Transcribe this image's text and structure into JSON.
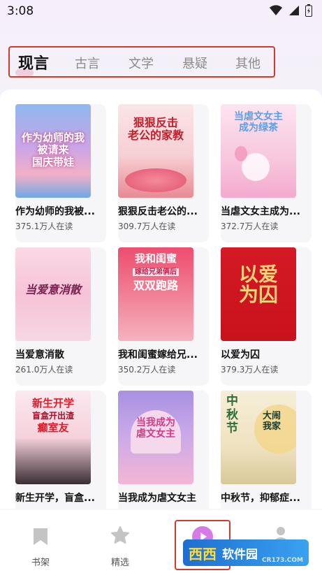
{
  "status": {
    "time": "3:08"
  },
  "tabs": [
    {
      "label": "现言",
      "active": true
    },
    {
      "label": "古言",
      "active": false
    },
    {
      "label": "文学",
      "active": false
    },
    {
      "label": "悬疑",
      "active": false
    },
    {
      "label": "其他",
      "active": false
    }
  ],
  "books": [
    {
      "title": "作为幼师的我被...",
      "readers": "375.1万人在读",
      "cover_text": "作为幼师的我 被请来 国庆带娃"
    },
    {
      "title": "狠狠反击老公的...",
      "readers": "309.7万人在读",
      "cover_text": "狠狠反击 老公的家教"
    },
    {
      "title": "当虐文女主成为...",
      "readers": "372.7万人在读",
      "cover_text": "当虐文女主 成为绿茶"
    },
    {
      "title": "当爱意消散",
      "readers": "261.0万人在读",
      "cover_text": "当爱意消散"
    },
    {
      "title": "我和闺蜜嫁给兄...",
      "readers": "350.2万人在读",
      "cover_text": "我和闺蜜 嫁给兄弟俩后 双双跑路"
    },
    {
      "title": "以爱为囚",
      "readers": "379.3万人在读",
      "cover_text": "以爱为囚"
    },
    {
      "title": "新生开学，盲盒...",
      "readers": "",
      "cover_text": "新生开学 盲盒开出渣 癫室友"
    },
    {
      "title": "当我成为虐文女主",
      "readers": "",
      "cover_text": "当我成为 虐文女主"
    },
    {
      "title": "中秋节，抑郁症...",
      "readers": "",
      "cover_text": "中秋节 大闹我家"
    }
  ],
  "nav": [
    {
      "label": "书架",
      "icon": "bookmark-icon"
    },
    {
      "label": "精选",
      "icon": "star-icon"
    },
    {
      "label": "",
      "icon": "play-icon"
    },
    {
      "label": "",
      "icon": "profile-icon"
    }
  ],
  "watermark": {
    "brand": "西西",
    "site": "软件园",
    "url": "CR173.COM"
  }
}
